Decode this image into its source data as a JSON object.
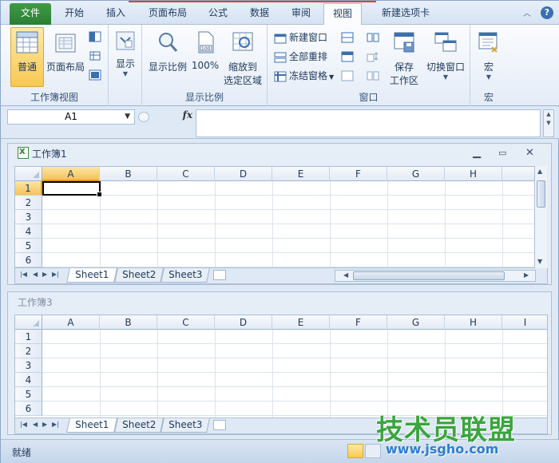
{
  "tabs": [
    {
      "label": "文件"
    },
    {
      "label": "开始"
    },
    {
      "label": "插入"
    },
    {
      "label": "页面布局"
    },
    {
      "label": "公式"
    },
    {
      "label": "数据"
    },
    {
      "label": "审阅"
    },
    {
      "label": "视图"
    },
    {
      "label": "新建选项卡"
    }
  ],
  "ribbon": {
    "workbook_views": {
      "label": "工作簿视图",
      "normal": "普通",
      "page_layout": "页面布局"
    },
    "show": {
      "label": "显示"
    },
    "zoom": {
      "label": "显示比例",
      "zoom": "显示比例",
      "zoom_100": "100%",
      "zoom_selection_line1": "缩放到",
      "zoom_selection_line2": "选定区域"
    },
    "window": {
      "label": "窗口",
      "new_window": "新建窗口",
      "arrange_all": "全部重排",
      "freeze_panes": "冻结窗格",
      "save_workspace_line1": "保存",
      "save_workspace_line2": "工作区",
      "switch_windows": "切换窗口"
    },
    "macros": {
      "label": "宏",
      "macros": "宏"
    }
  },
  "formula_bar": {
    "name_box": "A1",
    "fx": "fx",
    "value": ""
  },
  "columns": [
    "A",
    "B",
    "C",
    "D",
    "E",
    "F",
    "G",
    "H",
    "I"
  ],
  "rows": [
    "1",
    "2",
    "3",
    "4",
    "5",
    "6"
  ],
  "workbook1": {
    "title": "工作簿1",
    "sheets": [
      "Sheet1",
      "Sheet2",
      "Sheet3"
    ],
    "active_cell": "A1"
  },
  "workbook3": {
    "title": "工作簿3",
    "sheets": [
      "Sheet1",
      "Sheet2",
      "Sheet3"
    ]
  },
  "status": {
    "ready": "就绪"
  },
  "watermark": {
    "brand": "技术员联盟",
    "url": "www.jsgho.com"
  },
  "colors": {
    "file_tab": "#2a7f33",
    "selected": "#f8c853",
    "accent": "#1e395b"
  }
}
